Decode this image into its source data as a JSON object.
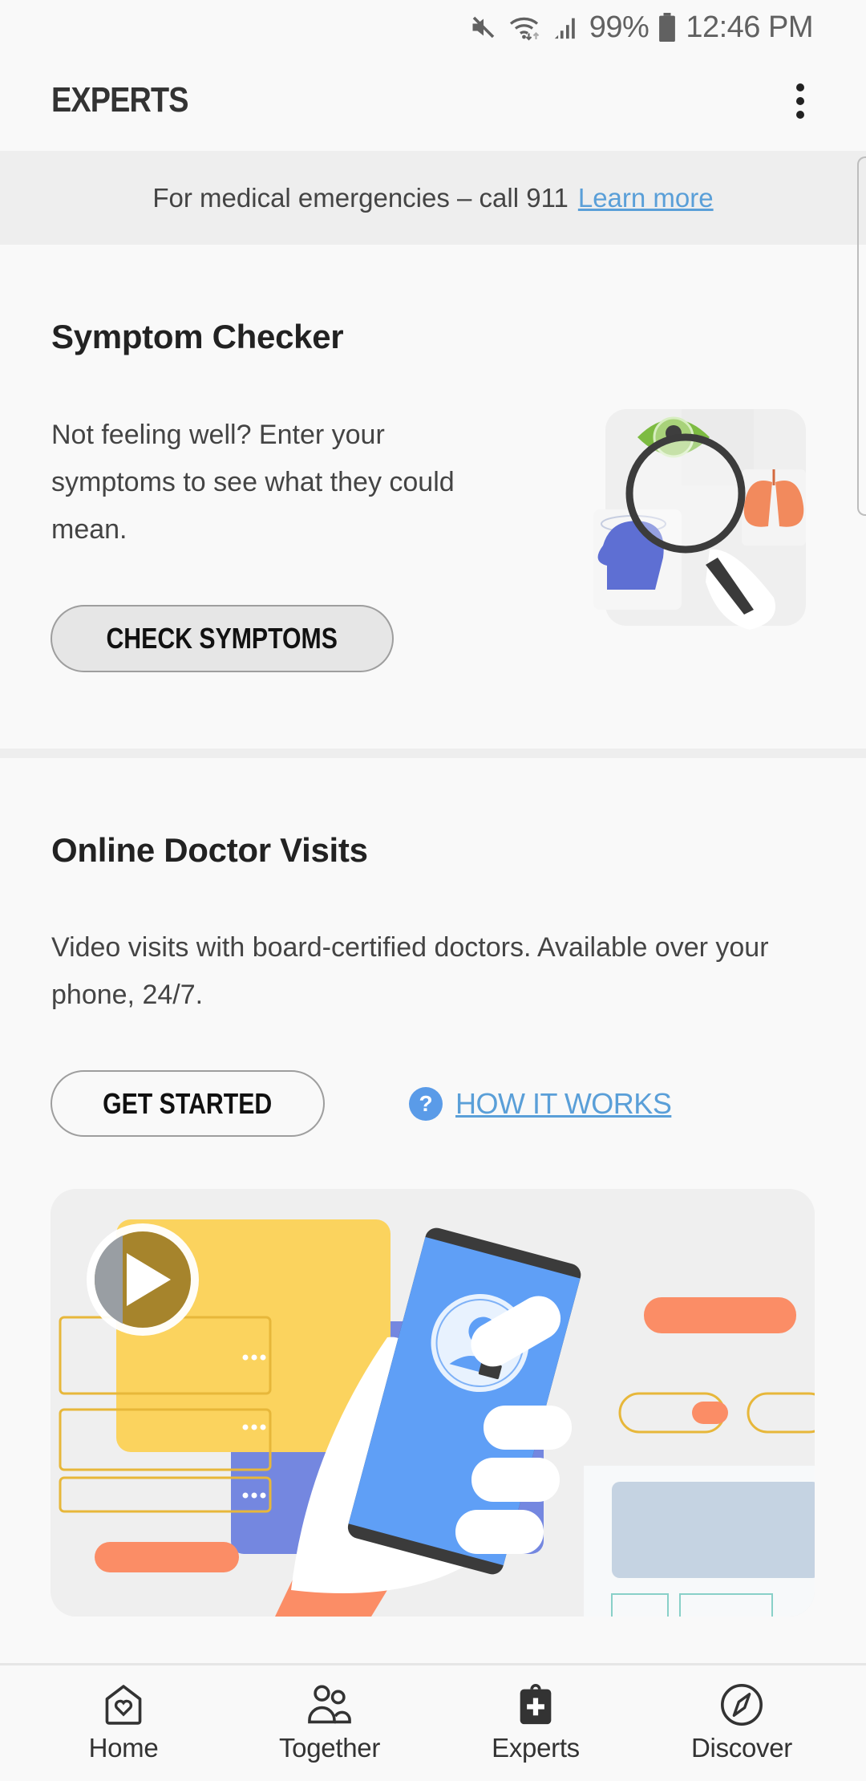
{
  "status_bar": {
    "battery": "99%",
    "time": "12:46 PM",
    "icons": [
      "mute-icon",
      "wifi-icon",
      "signal-icon",
      "battery-icon"
    ]
  },
  "header": {
    "title": "EXPERTS",
    "more_icon": "more-vert-icon"
  },
  "banner": {
    "text": "For medical emergencies – call 911",
    "link": "Learn more"
  },
  "symptom_checker": {
    "title": "Symptom Checker",
    "body": "Not feeling well? Enter your symptoms to see what they could mean.",
    "button": "CHECK SYMPTOMS",
    "illustration": "magnifier-over-eye-lungs-head-illustration"
  },
  "online_doctor": {
    "title": "Online Doctor Visits",
    "body": "Video visits with board-certified doctors. Available over your phone, 24/7.",
    "primary_button": "GET STARTED",
    "help_icon": "?",
    "secondary_link": "HOW IT WORKS",
    "video": "doctor-video-call-illustration"
  },
  "bottom_nav": {
    "items": [
      {
        "label": "Home",
        "icon": "home-heart-icon",
        "active": false
      },
      {
        "label": "Together",
        "icon": "people-icon",
        "active": false
      },
      {
        "label": "Experts",
        "icon": "medical-kit-icon",
        "active": true
      },
      {
        "label": "Discover",
        "icon": "compass-icon",
        "active": false
      }
    ]
  },
  "colors": {
    "accent_link": "#5a9fd8",
    "help_icon": "#5a9be8",
    "banner_bg": "#eeeeee",
    "background": "#f9f9f9"
  }
}
